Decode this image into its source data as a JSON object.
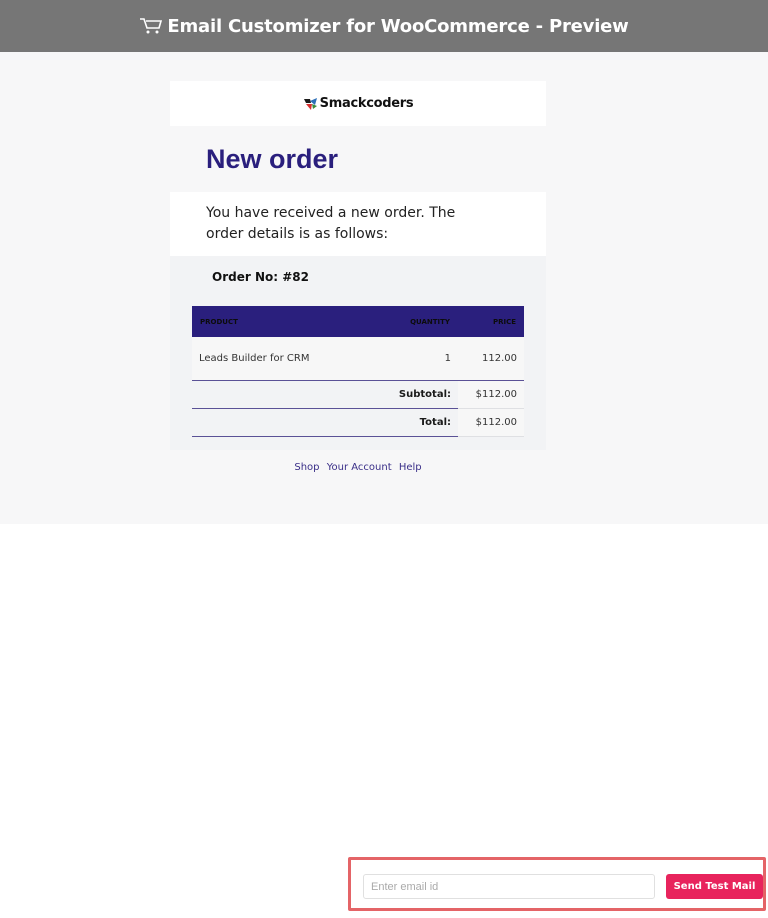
{
  "header": {
    "title": "Email Customizer for WooCommerce - Preview",
    "icon": "cart-icon"
  },
  "email": {
    "logo_text": "Smackcoders",
    "heading": "New order",
    "intro": "You have received a new order. The order details is as follows:",
    "order_no": "Order No: #82",
    "table": {
      "headers": [
        "PRODUCT",
        "QUANTITY",
        "PRICE"
      ],
      "rows": [
        {
          "product": "Leads Builder for CRM",
          "quantity": "1",
          "price": "112.00"
        }
      ],
      "subtotal_label": "Subtotal:",
      "subtotal_value": "$112.00",
      "total_label": "Total:",
      "total_value": "$112.00"
    },
    "footer_links": [
      "Shop",
      "Your Account",
      "Help"
    ]
  },
  "test_mail": {
    "placeholder": "Enter email id",
    "value": "",
    "button_label": "Send Test Mail"
  },
  "colors": {
    "topbar": "#767676",
    "heading": "#2a1f7d",
    "table_header": "#2a1f7d",
    "button": "#e8245d",
    "highlight_border": "#e46467"
  }
}
